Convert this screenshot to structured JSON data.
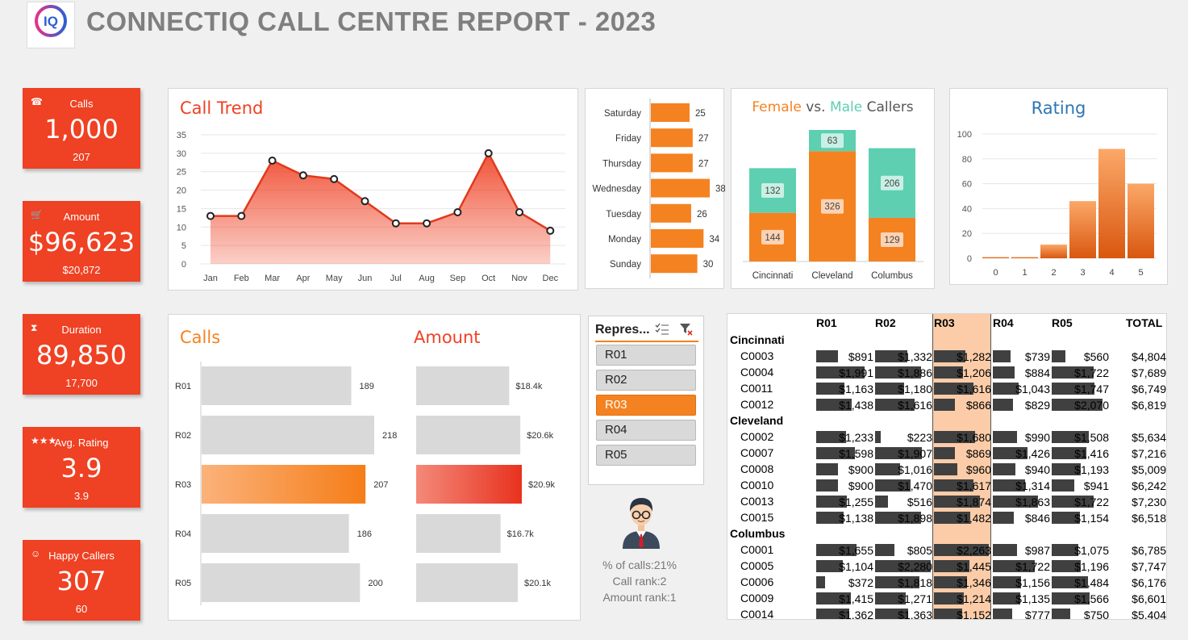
{
  "header": {
    "title": "CONNECTIQ CALL CENTRE REPORT - 2023",
    "logo_text": "IQ"
  },
  "kpis": [
    {
      "id": "calls",
      "icon": "phone-icon",
      "glyph": "☎",
      "label": "Calls",
      "value": "1,000",
      "sub": "207"
    },
    {
      "id": "amount",
      "icon": "cart-icon",
      "glyph": "🛒",
      "label": "Amount",
      "value": "$96,623",
      "sub": "$20,872"
    },
    {
      "id": "duration",
      "icon": "hourglass-icon",
      "glyph": "⧗",
      "label": "Duration",
      "value": "89,850",
      "sub": "17,700"
    },
    {
      "id": "rating",
      "icon": "stars-icon",
      "glyph": "★★★",
      "label": "Avg. Rating",
      "value": "3.9",
      "sub": "3.9"
    },
    {
      "id": "happy",
      "icon": "smiley-icon",
      "glyph": "☺",
      "label": "Happy Callers",
      "value": "307",
      "sub": "60"
    }
  ],
  "charts": {
    "trend": {
      "title": "Call Trend",
      "type": "area",
      "categories": [
        "Jan",
        "Feb",
        "Mar",
        "Apr",
        "May",
        "Jun",
        "Jul",
        "Aug",
        "Sep",
        "Oct",
        "Nov",
        "Dec"
      ],
      "values": [
        13,
        13,
        28,
        24,
        23,
        17,
        11,
        11,
        14,
        30,
        14,
        9
      ],
      "yticks": [
        "0",
        "5",
        "10",
        "15",
        "20",
        "25",
        "30",
        "35"
      ],
      "ylim": [
        0,
        35
      ]
    },
    "weekday": {
      "type": "bar",
      "categories": [
        "Saturday",
        "Friday",
        "Thursday",
        "Wednesday",
        "Tuesday",
        "Monday",
        "Sunday"
      ],
      "values": [
        25,
        27,
        27,
        38,
        26,
        34,
        30
      ]
    },
    "gender": {
      "title_female": "Female",
      "title_vs": " vs. ",
      "title_male": "Male",
      "title_callers": " Callers",
      "type": "bar",
      "categories": [
        "Cincinnati",
        "Cleveland",
        "Columbus"
      ],
      "female": [
        144,
        326,
        129
      ],
      "male": [
        132,
        63,
        206
      ]
    },
    "rating": {
      "title": "Rating",
      "type": "bar",
      "categories": [
        "0",
        "1",
        "2",
        "3",
        "4",
        "5"
      ],
      "values": [
        1,
        1,
        11,
        46,
        88,
        60
      ],
      "yticks": [
        "0",
        "20",
        "40",
        "60",
        "80",
        "100"
      ],
      "ylim": [
        0,
        100
      ]
    },
    "rep_calls": {
      "title": "Calls",
      "type": "bar",
      "categories": [
        "R01",
        "R02",
        "R03",
        "R04",
        "R05"
      ],
      "values": [
        189,
        218,
        207,
        186,
        200
      ],
      "labels": [
        "189",
        "218",
        "207",
        "186",
        "200"
      ],
      "highlight": "R03"
    },
    "rep_amount": {
      "title": "Amount",
      "type": "bar",
      "categories": [
        "R01",
        "R02",
        "R03",
        "R04",
        "R05"
      ],
      "values": [
        18.4,
        20.6,
        20.9,
        16.7,
        20.1
      ],
      "labels": [
        "$18.4k",
        "$20.6k",
        "$20.9k",
        "$16.7k",
        "$20.1k"
      ],
      "highlight": "R03"
    }
  },
  "slicer": {
    "header": "Repres...",
    "items": [
      "R01",
      "R02",
      "R03",
      "R04",
      "R05"
    ],
    "selected": "R03"
  },
  "rep_info": {
    "pct_calls": "% of calls:21%",
    "call_rank": "Call rank:2",
    "amount_rank": "Amount rank:1"
  },
  "pivot": {
    "headers": [
      "R01",
      "R02",
      "R03",
      "R04",
      "R05",
      "TOTAL"
    ],
    "groups": [
      {
        "city": "Cincinnati",
        "rows": [
          {
            "code": "C0003",
            "values": [
              "$891",
              "$1,332",
              "$1,282",
              "$739",
              "$560"
            ],
            "raw": [
              891,
              1332,
              1282,
              739,
              560
            ],
            "total": "$4,804"
          },
          {
            "code": "C0004",
            "values": [
              "$1,991",
              "$1,886",
              "$1,206",
              "$884",
              "$1,722"
            ],
            "raw": [
              1991,
              1886,
              1206,
              884,
              1722
            ],
            "total": "$7,689"
          },
          {
            "code": "C0011",
            "values": [
              "$1,163",
              "$1,180",
              "$1,616",
              "$1,043",
              "$1,747"
            ],
            "raw": [
              1163,
              1180,
              1616,
              1043,
              1747
            ],
            "total": "$6,749"
          },
          {
            "code": "C0012",
            "values": [
              "$1,438",
              "$1,616",
              "$866",
              "$829",
              "$2,070"
            ],
            "raw": [
              1438,
              1616,
              866,
              829,
              2070
            ],
            "total": "$6,819"
          }
        ]
      },
      {
        "city": "Cleveland",
        "rows": [
          {
            "code": "C0002",
            "values": [
              "$1,233",
              "$223",
              "$1,680",
              "$990",
              "$1,508"
            ],
            "raw": [
              1233,
              223,
              1680,
              990,
              1508
            ],
            "total": "$5,634"
          },
          {
            "code": "C0007",
            "values": [
              "$1,598",
              "$1,907",
              "$869",
              "$1,426",
              "$1,416"
            ],
            "raw": [
              1598,
              1907,
              869,
              1426,
              1416
            ],
            "total": "$7,216"
          },
          {
            "code": "C0008",
            "values": [
              "$900",
              "$1,016",
              "$960",
              "$940",
              "$1,193"
            ],
            "raw": [
              900,
              1016,
              960,
              940,
              1193
            ],
            "total": "$5,009"
          },
          {
            "code": "C0010",
            "values": [
              "$900",
              "$1,470",
              "$1,617",
              "$1,314",
              "$941"
            ],
            "raw": [
              900,
              1470,
              1617,
              1314,
              941
            ],
            "total": "$6,242"
          },
          {
            "code": "C0013",
            "values": [
              "$1,255",
              "$516",
              "$1,874",
              "$1,863",
              "$1,722"
            ],
            "raw": [
              1255,
              516,
              1874,
              1863,
              1722
            ],
            "total": "$7,230"
          },
          {
            "code": "C0015",
            "values": [
              "$1,138",
              "$1,898",
              "$1,482",
              "$846",
              "$1,154"
            ],
            "raw": [
              1138,
              1898,
              1482,
              846,
              1154
            ],
            "total": "$6,518"
          }
        ]
      },
      {
        "city": "Columbus",
        "rows": [
          {
            "code": "C0001",
            "values": [
              "$1,655",
              "$805",
              "$2,263",
              "$987",
              "$1,075"
            ],
            "raw": [
              1655,
              805,
              2263,
              987,
              1075
            ],
            "total": "$6,785"
          },
          {
            "code": "C0005",
            "values": [
              "$1,104",
              "$2,280",
              "$1,445",
              "$1,722",
              "$1,196"
            ],
            "raw": [
              1104,
              2280,
              1445,
              1722,
              1196
            ],
            "total": "$7,747"
          },
          {
            "code": "C0006",
            "values": [
              "$372",
              "$1,818",
              "$1,346",
              "$1,156",
              "$1,484"
            ],
            "raw": [
              372,
              1818,
              1346,
              1156,
              1484
            ],
            "total": "$6,176"
          },
          {
            "code": "C0009",
            "values": [
              "$1,415",
              "$1,271",
              "$1,214",
              "$1,135",
              "$1,566"
            ],
            "raw": [
              1415,
              1271,
              1214,
              1135,
              1566
            ],
            "total": "$6,601"
          },
          {
            "code": "C0014",
            "values": [
              "$1,362",
              "$1,363",
              "$1,152",
              "$777",
              "$750"
            ],
            "raw": [
              1362,
              1363,
              1152,
              777,
              750
            ],
            "total": "$5,404"
          }
        ]
      }
    ]
  },
  "colors": {
    "accent": "#ef4123",
    "orange": "#f58220",
    "teal": "#5ecfb1",
    "blue": "#2e75b6",
    "gray_bar": "#d9d9d9"
  }
}
